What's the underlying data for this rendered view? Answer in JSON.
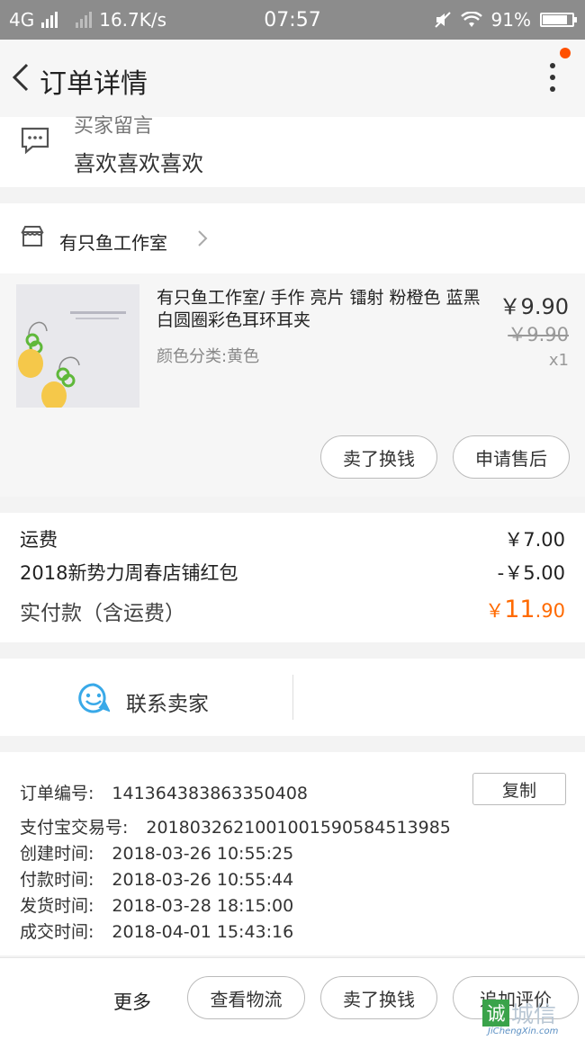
{
  "status_bar": {
    "network": "4G",
    "speed": "16.7K/s",
    "time": "07:57",
    "battery": "91%",
    "battery_level": 0.91
  },
  "nav": {
    "title": "订单详情"
  },
  "message": {
    "label": "买家留言",
    "text": "喜欢喜欢喜欢"
  },
  "shop": {
    "name": "有只鱼工作室"
  },
  "item": {
    "title": "有只鱼工作室/ 手作 亮片 镭射 粉橙色 蓝黑白圆圈彩色耳环耳夹",
    "sku": "颜色分类:黄色",
    "price": "￥9.90",
    "original_price": "￥9.90",
    "quantity": "x1",
    "buttons": [
      "卖了换钱",
      "申请售后"
    ]
  },
  "fees": {
    "shipping_label": "运费",
    "shipping_value": "￥7.00",
    "coupon_label": "2018新势力周春店铺红包",
    "coupon_value": "-￥5.00",
    "paid_label": "实付款（含运费）",
    "paid_currency": "￥",
    "paid_int": "11",
    "paid_dec": ".90"
  },
  "contact": {
    "label": "联系卖家"
  },
  "order_info": {
    "copy_label": "复制",
    "rows": [
      {
        "label": "订单编号:",
        "value": "141364383863350408"
      },
      {
        "label": "支付宝交易号:",
        "value": "2018032621001001590584513985"
      },
      {
        "label": "创建时间:",
        "value": "2018-03-26 10:55:25"
      },
      {
        "label": "付款时间:",
        "value": "2018-03-26 10:55:44"
      },
      {
        "label": "发货时间:",
        "value": "2018-03-28 18:15:00"
      },
      {
        "label": "成交时间:",
        "value": "2018-04-01 15:43:16"
      }
    ]
  },
  "bottom_bar": {
    "more": "更多",
    "buttons": [
      "查看物流",
      "卖了换钱",
      "追加评价"
    ]
  },
  "watermark": {
    "logo_char": "诚",
    "logo_text": "城信",
    "url": "JiChengXin.com"
  },
  "colors": {
    "accent": "#ff6a00",
    "notify_dot": "#ff5000",
    "contact_icon": "#39a9e8"
  }
}
